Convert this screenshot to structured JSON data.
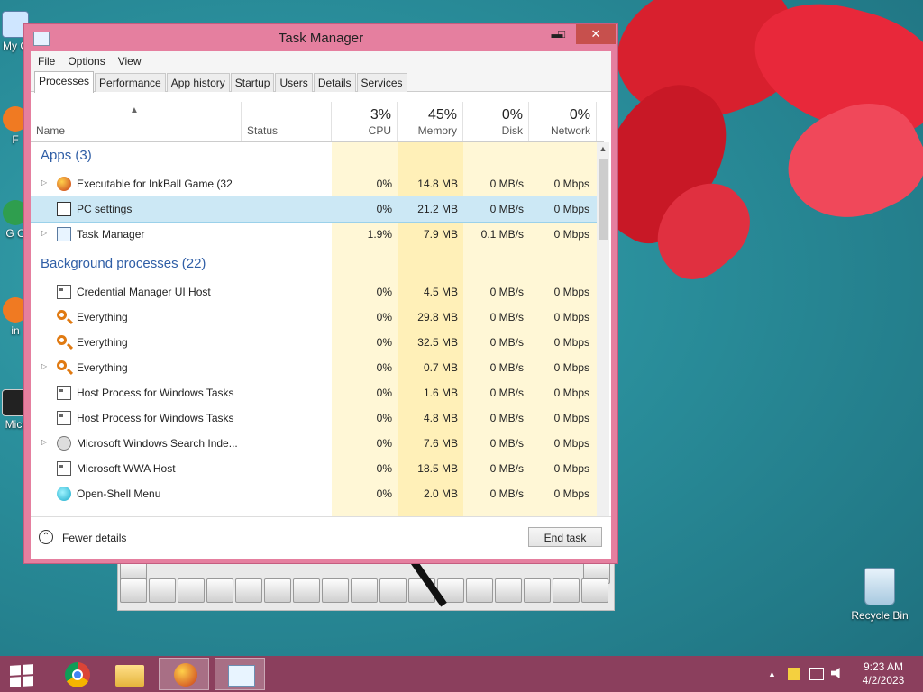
{
  "window": {
    "title": "Task Manager",
    "controls": {
      "minimize": "▬",
      "maximize": "□",
      "close": "✕"
    }
  },
  "menu": [
    "File",
    "Options",
    "View"
  ],
  "tabs": [
    "Processes",
    "Performance",
    "App history",
    "Startup",
    "Users",
    "Details",
    "Services"
  ],
  "columns": {
    "name": "Name",
    "status": "Status",
    "cpu": {
      "pct": "3%",
      "label": "CPU"
    },
    "memory": {
      "pct": "45%",
      "label": "Memory"
    },
    "disk": {
      "pct": "0%",
      "label": "Disk"
    },
    "network": {
      "pct": "0%",
      "label": "Network"
    }
  },
  "groups": {
    "apps": "Apps (3)",
    "background": "Background processes (22)"
  },
  "apps": [
    {
      "name": "Executable for InkBall Game (32 ...",
      "cpu": "0%",
      "memory": "14.8 MB",
      "disk": "0 MB/s",
      "network": "0 Mbps",
      "icon": "game-icon",
      "expander": "▷"
    },
    {
      "name": "PC settings",
      "cpu": "0%",
      "memory": "21.2 MB",
      "disk": "0 MB/s",
      "network": "0 Mbps",
      "icon": "settings-icon",
      "expander": ""
    },
    {
      "name": "Task Manager",
      "cpu": "1.9%",
      "memory": "7.9 MB",
      "disk": "0.1 MB/s",
      "network": "0 Mbps",
      "icon": "task-manager-icon",
      "expander": "▷"
    }
  ],
  "background": [
    {
      "name": "Credential Manager UI Host",
      "cpu": "0%",
      "memory": "4.5 MB",
      "disk": "0 MB/s",
      "network": "0 Mbps",
      "icon": "window-icon",
      "expander": ""
    },
    {
      "name": "Everything",
      "cpu": "0%",
      "memory": "29.8 MB",
      "disk": "0 MB/s",
      "network": "0 Mbps",
      "icon": "search-icon",
      "expander": ""
    },
    {
      "name": "Everything",
      "cpu": "0%",
      "memory": "32.5 MB",
      "disk": "0 MB/s",
      "network": "0 Mbps",
      "icon": "search-icon",
      "expander": ""
    },
    {
      "name": "Everything",
      "cpu": "0%",
      "memory": "0.7 MB",
      "disk": "0 MB/s",
      "network": "0 Mbps",
      "icon": "search-icon",
      "expander": "▷"
    },
    {
      "name": "Host Process for Windows Tasks",
      "cpu": "0%",
      "memory": "1.6 MB",
      "disk": "0 MB/s",
      "network": "0 Mbps",
      "icon": "window-icon",
      "expander": ""
    },
    {
      "name": "Host Process for Windows Tasks",
      "cpu": "0%",
      "memory": "4.8 MB",
      "disk": "0 MB/s",
      "network": "0 Mbps",
      "icon": "window-icon",
      "expander": ""
    },
    {
      "name": "Microsoft Windows Search Inde...",
      "cpu": "0%",
      "memory": "7.6 MB",
      "disk": "0 MB/s",
      "network": "0 Mbps",
      "icon": "user-icon",
      "expander": "▷"
    },
    {
      "name": "Microsoft WWA Host",
      "cpu": "0%",
      "memory": "18.5 MB",
      "disk": "0 MB/s",
      "network": "0 Mbps",
      "icon": "window-icon",
      "expander": ""
    },
    {
      "name": "Open-Shell Menu",
      "cpu": "0%",
      "memory": "2.0 MB",
      "disk": "0 MB/s",
      "network": "0 Mbps",
      "icon": "shell-icon",
      "expander": ""
    }
  ],
  "footer": {
    "fewer_details": "Fewer details",
    "end_task": "End task"
  },
  "desktop": {
    "recycle_bin": "Recycle Bin",
    "partial_labels": [
      "My C",
      "F",
      "G C",
      "in",
      "Micr"
    ]
  },
  "taskbar": {
    "time": "9:23 AM",
    "date": "4/2/2023",
    "tray_chevron": "▲"
  },
  "colors": {
    "window_frame": "#e57f9f",
    "taskbar": "#8b3f5d",
    "group_title": "#2f5ea6",
    "heat_light": "#fff7d6",
    "heat_memory": "#fff0b8",
    "selected_row": "#cce8f5"
  }
}
